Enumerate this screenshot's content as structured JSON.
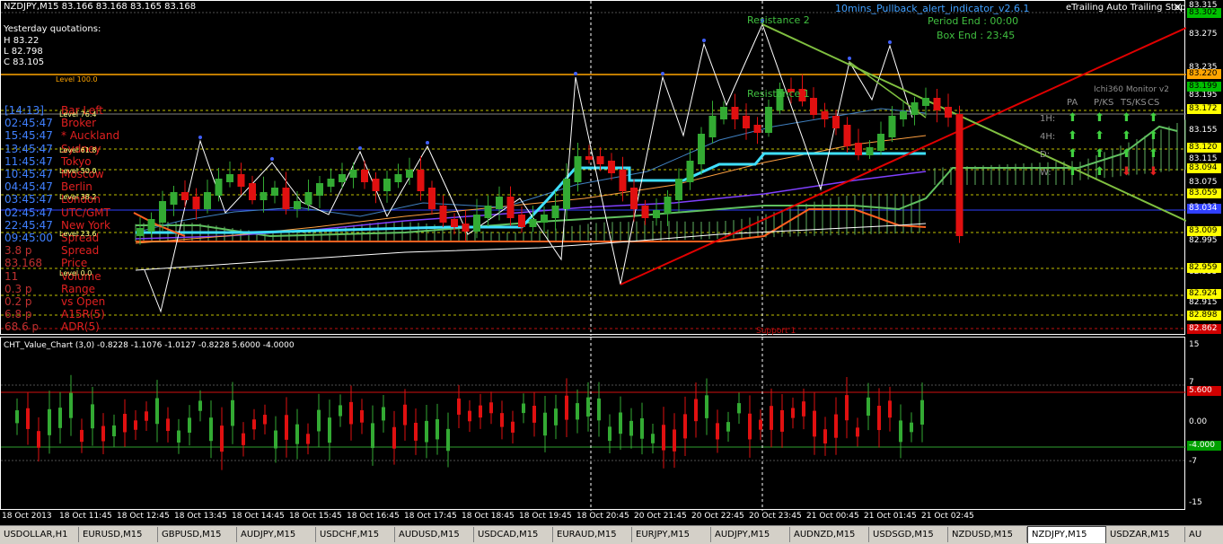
{
  "main": {
    "header": "NZDJPY,M15  83.166 83.168 83.165 83.168",
    "indicator_title": "10mins_Pullback_alert_indicator_v2.6.1",
    "trailing_title": "eTrailing Auto Trailing Stop",
    "close_x": "×",
    "period_end": "Period End : 00:00",
    "box_end": "Box End : 23:45",
    "resistance2": "Resistance 2",
    "resistance1": "Resistance 1",
    "support1": "Support 1",
    "monitor_title": "Ichi360 Monitor v2",
    "monitor_headers": [
      "PA",
      "P/KS",
      "TS/KS",
      "CS"
    ],
    "monitor_rows": [
      "1H:",
      "4H:",
      "D:",
      "W:"
    ],
    "yesterday": {
      "title": "Yesterday quotations:",
      "h": "H 83.22",
      "l": "L 82.798",
      "c": "C 83.105"
    },
    "level_100": "Level 100.0",
    "info_rows": [
      {
        "left": "[14:13]",
        "right": "Bar Left"
      },
      {
        "left": "02:45:47",
        "right": "Broker"
      },
      {
        "left": "15:45:47",
        "right": "* Auckland"
      },
      {
        "left": "13:45:47",
        "right": "Sydney"
      },
      {
        "left": "11:45:47",
        "right": "Tokyo"
      },
      {
        "left": "10:45:47",
        "right": "Moscow"
      },
      {
        "left": "04:45:47",
        "right": "Berlin"
      },
      {
        "left": "03:45:47",
        "right": "London"
      },
      {
        "left": "02:45:47",
        "right": "UTC/GMT"
      },
      {
        "left": "22:45:47",
        "right": "New York"
      },
      {
        "left": "09:45:00",
        "right": "Spread"
      },
      {
        "left": "3.8 p",
        "right": "Spread"
      },
      {
        "left": "83.168",
        "right": "Price"
      },
      {
        "left": "11",
        "right": "Volume"
      },
      {
        "left": "0.3 p",
        "right": "Range"
      },
      {
        "left": "0.2 p",
        "right": "vs Open"
      },
      {
        "left": "6.8 p",
        "right": "A15R(5)"
      },
      {
        "left": "68.6 p",
        "right": "ADR(5)"
      }
    ],
    "fib_levels": [
      "Level 100.0",
      "Level 76.4",
      "Level 61.8",
      "Level 50.0",
      "Level 38.2",
      "Level 23.6",
      "Level 0.0"
    ]
  },
  "sub": {
    "header": "CHT_Value_Chart (3,0) -0.8228 -1.1076 -1.0127 -0.8228 5.6000 -4.0000"
  },
  "price_axis": {
    "labels": [
      "83.315",
      "83.275",
      "83.235",
      "83.195",
      "83.155",
      "83.115",
      "83.075",
      "83.035",
      "82.995",
      "82.955",
      "82.915",
      "82.875"
    ],
    "badges": [
      {
        "text": "83.302",
        "color": "#00c000"
      },
      {
        "text": "83.220",
        "color": "#ffa500"
      },
      {
        "text": "83.199",
        "color": "#00c000"
      },
      {
        "text": "83.172",
        "color": "#ffff00"
      },
      {
        "text": "83.120",
        "color": "#ffff00"
      },
      {
        "text": "83.094",
        "color": "#ffff00"
      },
      {
        "text": "83.059",
        "color": "#ffff00"
      },
      {
        "text": "83.034",
        "color": "#3040ff"
      },
      {
        "text": "83.009",
        "color": "#ffff00"
      },
      {
        "text": "82.959",
        "color": "#ffff00"
      },
      {
        "text": "82.924",
        "color": "#ffff00"
      },
      {
        "text": "82.898",
        "color": "#ffff00"
      },
      {
        "text": "82.862",
        "color": "#d00000"
      }
    ]
  },
  "sub_axis": {
    "labels": [
      "15",
      "7",
      "0.00",
      "-7",
      "-15"
    ],
    "badges": [
      {
        "text": "5.600",
        "color": "#d00000"
      },
      {
        "text": "-4.000",
        "color": "#00a000"
      }
    ]
  },
  "time_axis": [
    "18 Oct 2013",
    "18 Oct 11:45",
    "18 Oct 12:45",
    "18 Oct 13:45",
    "18 Oct 14:45",
    "18 Oct 15:45",
    "18 Oct 16:45",
    "18 Oct 17:45",
    "18 Oct 18:45",
    "18 Oct 19:45",
    "18 Oct 20:45",
    "20 Oct 21:45",
    "20 Oct 22:45",
    "20 Oct 23:45",
    "21 Oct 00:45",
    "21 Oct 01:45",
    "21 Oct 02:45"
  ],
  "tabs": [
    {
      "label": "USDOLLAR,H1",
      "active": false
    },
    {
      "label": "EURUSD,M15",
      "active": false
    },
    {
      "label": "GBPUSD,M15",
      "active": false
    },
    {
      "label": "AUDJPY,M15",
      "active": false
    },
    {
      "label": "USDCHF,M15",
      "active": false
    },
    {
      "label": "AUDUSD,M15",
      "active": false
    },
    {
      "label": "USDCAD,M15",
      "active": false
    },
    {
      "label": "EURAUD,M15",
      "active": false
    },
    {
      "label": "EURJPY,M15",
      "active": false
    },
    {
      "label": "AUDJPY,M15",
      "active": false
    },
    {
      "label": "AUDNZD,M15",
      "active": false
    },
    {
      "label": "USDSGD,M15",
      "active": false
    },
    {
      "label": "NZDUSD,M15",
      "active": false
    },
    {
      "label": "NZDJPY,M15",
      "active": true
    },
    {
      "label": "USDZAR,M15",
      "active": false
    },
    {
      "label": "AU",
      "active": false
    }
  ],
  "colors": {
    "bull": "#33aa33",
    "bear": "#e01010",
    "resistance": "#80c040",
    "trend_red": "#e00000",
    "cyan": "#40e0ff",
    "orange": "#ffa500"
  }
}
